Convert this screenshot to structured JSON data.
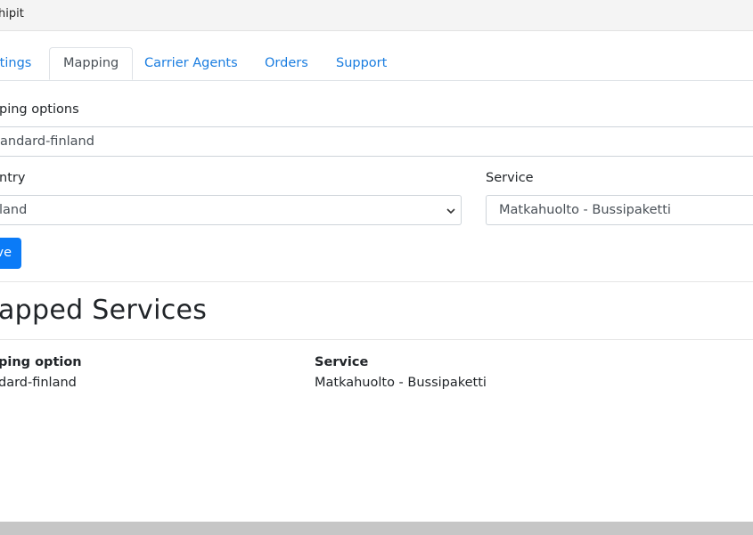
{
  "window": {
    "title": "hipit"
  },
  "tabs": [
    {
      "label": "ttings"
    },
    {
      "label": "Mapping"
    },
    {
      "label": "Carrier Agents"
    },
    {
      "label": "Orders"
    },
    {
      "label": "Support"
    }
  ],
  "form": {
    "shipping_options_label": "ping options",
    "shipping_options_value": "andard-finland",
    "country_label": "ntry",
    "country_value": "land",
    "service_label": "Service",
    "service_value": "Matkahuolto - Bussipaketti",
    "save_label": "ve"
  },
  "mapped": {
    "title": "apped Services",
    "headers": {
      "option": "ping option",
      "service": "Service"
    },
    "rows": [
      {
        "option": "dard-finland",
        "service": "Matkahuolto - Bussipaketti"
      }
    ]
  }
}
